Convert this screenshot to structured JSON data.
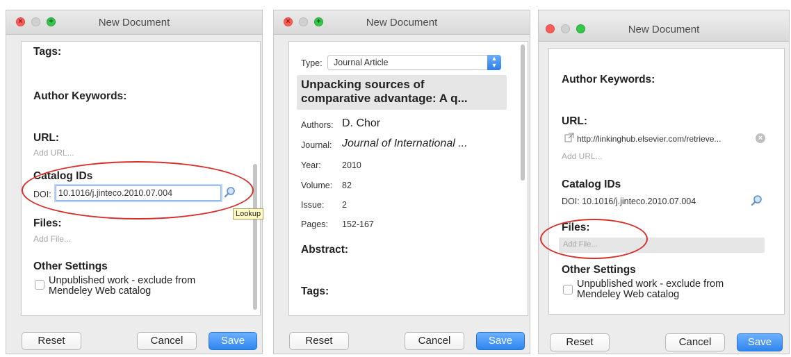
{
  "windows": [
    {
      "title": "New Document",
      "fields": {
        "tags_label": "Tags:",
        "author_keywords_label": "Author Keywords:",
        "url_label": "URL:",
        "add_url": "Add URL...",
        "catalog_ids_label": "Catalog IDs",
        "doi_label": "DOI:",
        "doi_value": "10.1016/j.jinteco.2010.07.004",
        "lookup_tooltip": "Lookup",
        "files_label": "Files:",
        "add_file": "Add File...",
        "other_settings_label": "Other Settings",
        "unpublished_line1": "Unpublished work - exclude from",
        "unpublished_line2": "Mendeley Web catalog"
      },
      "buttons": {
        "reset": "Reset",
        "cancel": "Cancel",
        "save": "Save"
      }
    },
    {
      "title": "New Document",
      "fields": {
        "type_label": "Type:",
        "type_value": "Journal Article",
        "title_line1": "Unpacking sources of",
        "title_line2": "comparative advantage: A q...",
        "authors_label": "Authors:",
        "authors_value": "D. Chor",
        "journal_label": "Journal:",
        "journal_value": "Journal of International ...",
        "year_label": "Year:",
        "year_value": "2010",
        "volume_label": "Volume:",
        "volume_value": "82",
        "issue_label": "Issue:",
        "issue_value": "2",
        "pages_label": "Pages:",
        "pages_value": "152-167",
        "abstract_label": "Abstract:",
        "tags_label": "Tags:"
      },
      "buttons": {
        "reset": "Reset",
        "cancel": "Cancel",
        "save": "Save"
      }
    },
    {
      "title": "New Document",
      "fields": {
        "author_keywords_label": "Author Keywords:",
        "url_label": "URL:",
        "url_value": "http://linkinghub.elsevier.com/retrieve...",
        "add_url": "Add URL...",
        "catalog_ids_label": "Catalog IDs",
        "doi_text": "DOI: 10.1016/j.jinteco.2010.07.004",
        "files_label": "Files:",
        "add_file": "Add File...",
        "other_settings_label": "Other Settings",
        "unpublished_line1": "Unpublished work - exclude from",
        "unpublished_line2": "Mendeley Web catalog"
      },
      "buttons": {
        "reset": "Reset",
        "cancel": "Cancel",
        "save": "Save"
      }
    }
  ],
  "colors": {
    "annotation_ring": "#d52f2a",
    "save_button": "#2f86ee",
    "close_button": "#fc5d57",
    "zoom_button": "#34c84a"
  },
  "icons": [
    "close-icon",
    "minimize-icon",
    "zoom-icon",
    "magnifier-icon",
    "stepper-icon",
    "link-icon",
    "clear-icon"
  ]
}
